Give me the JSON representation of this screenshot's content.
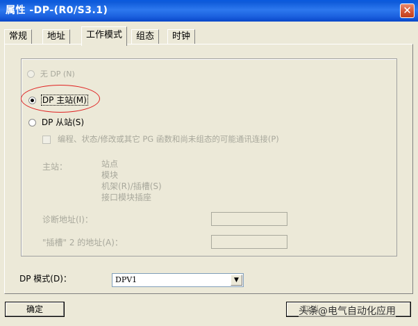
{
  "window": {
    "title": "属性 -DP-(R0/S3.1)",
    "close_icon": "close-icon"
  },
  "tabs": [
    {
      "label": "常规"
    },
    {
      "label": "地址"
    },
    {
      "label": "工作模式",
      "active": true
    },
    {
      "label": "组态"
    },
    {
      "label": "时钟"
    }
  ],
  "mode": {
    "none_label": "无 DP (N)",
    "master_label": "DP 主站(M)",
    "slave_label": "DP 从站(S)",
    "selected": "master",
    "checkbox_label": "编程、状态/修改或其它 PG 函数和尚未组态的可能通讯连接(P)",
    "master_info_label": "主站：",
    "master_info_lines": [
      "站点",
      "模块",
      "机架(R)/插槽(S)",
      "接口模块插座"
    ],
    "diag_address_label": "诊断地址(I)：",
    "diag_address_value": "",
    "slot2_address_label": "\"插槽\" 2 的地址(A)：",
    "slot2_address_value": ""
  },
  "dp_mode": {
    "label": "DP 模式(D)：",
    "value": "DPV1"
  },
  "buttons": {
    "ok": "确定",
    "cancel_partial": "取消"
  },
  "watermark": "头条@电气自动化应用",
  "colors": {
    "titlebar": "#2d78ee",
    "close": "#d45331",
    "highlight": "#e02020"
  }
}
